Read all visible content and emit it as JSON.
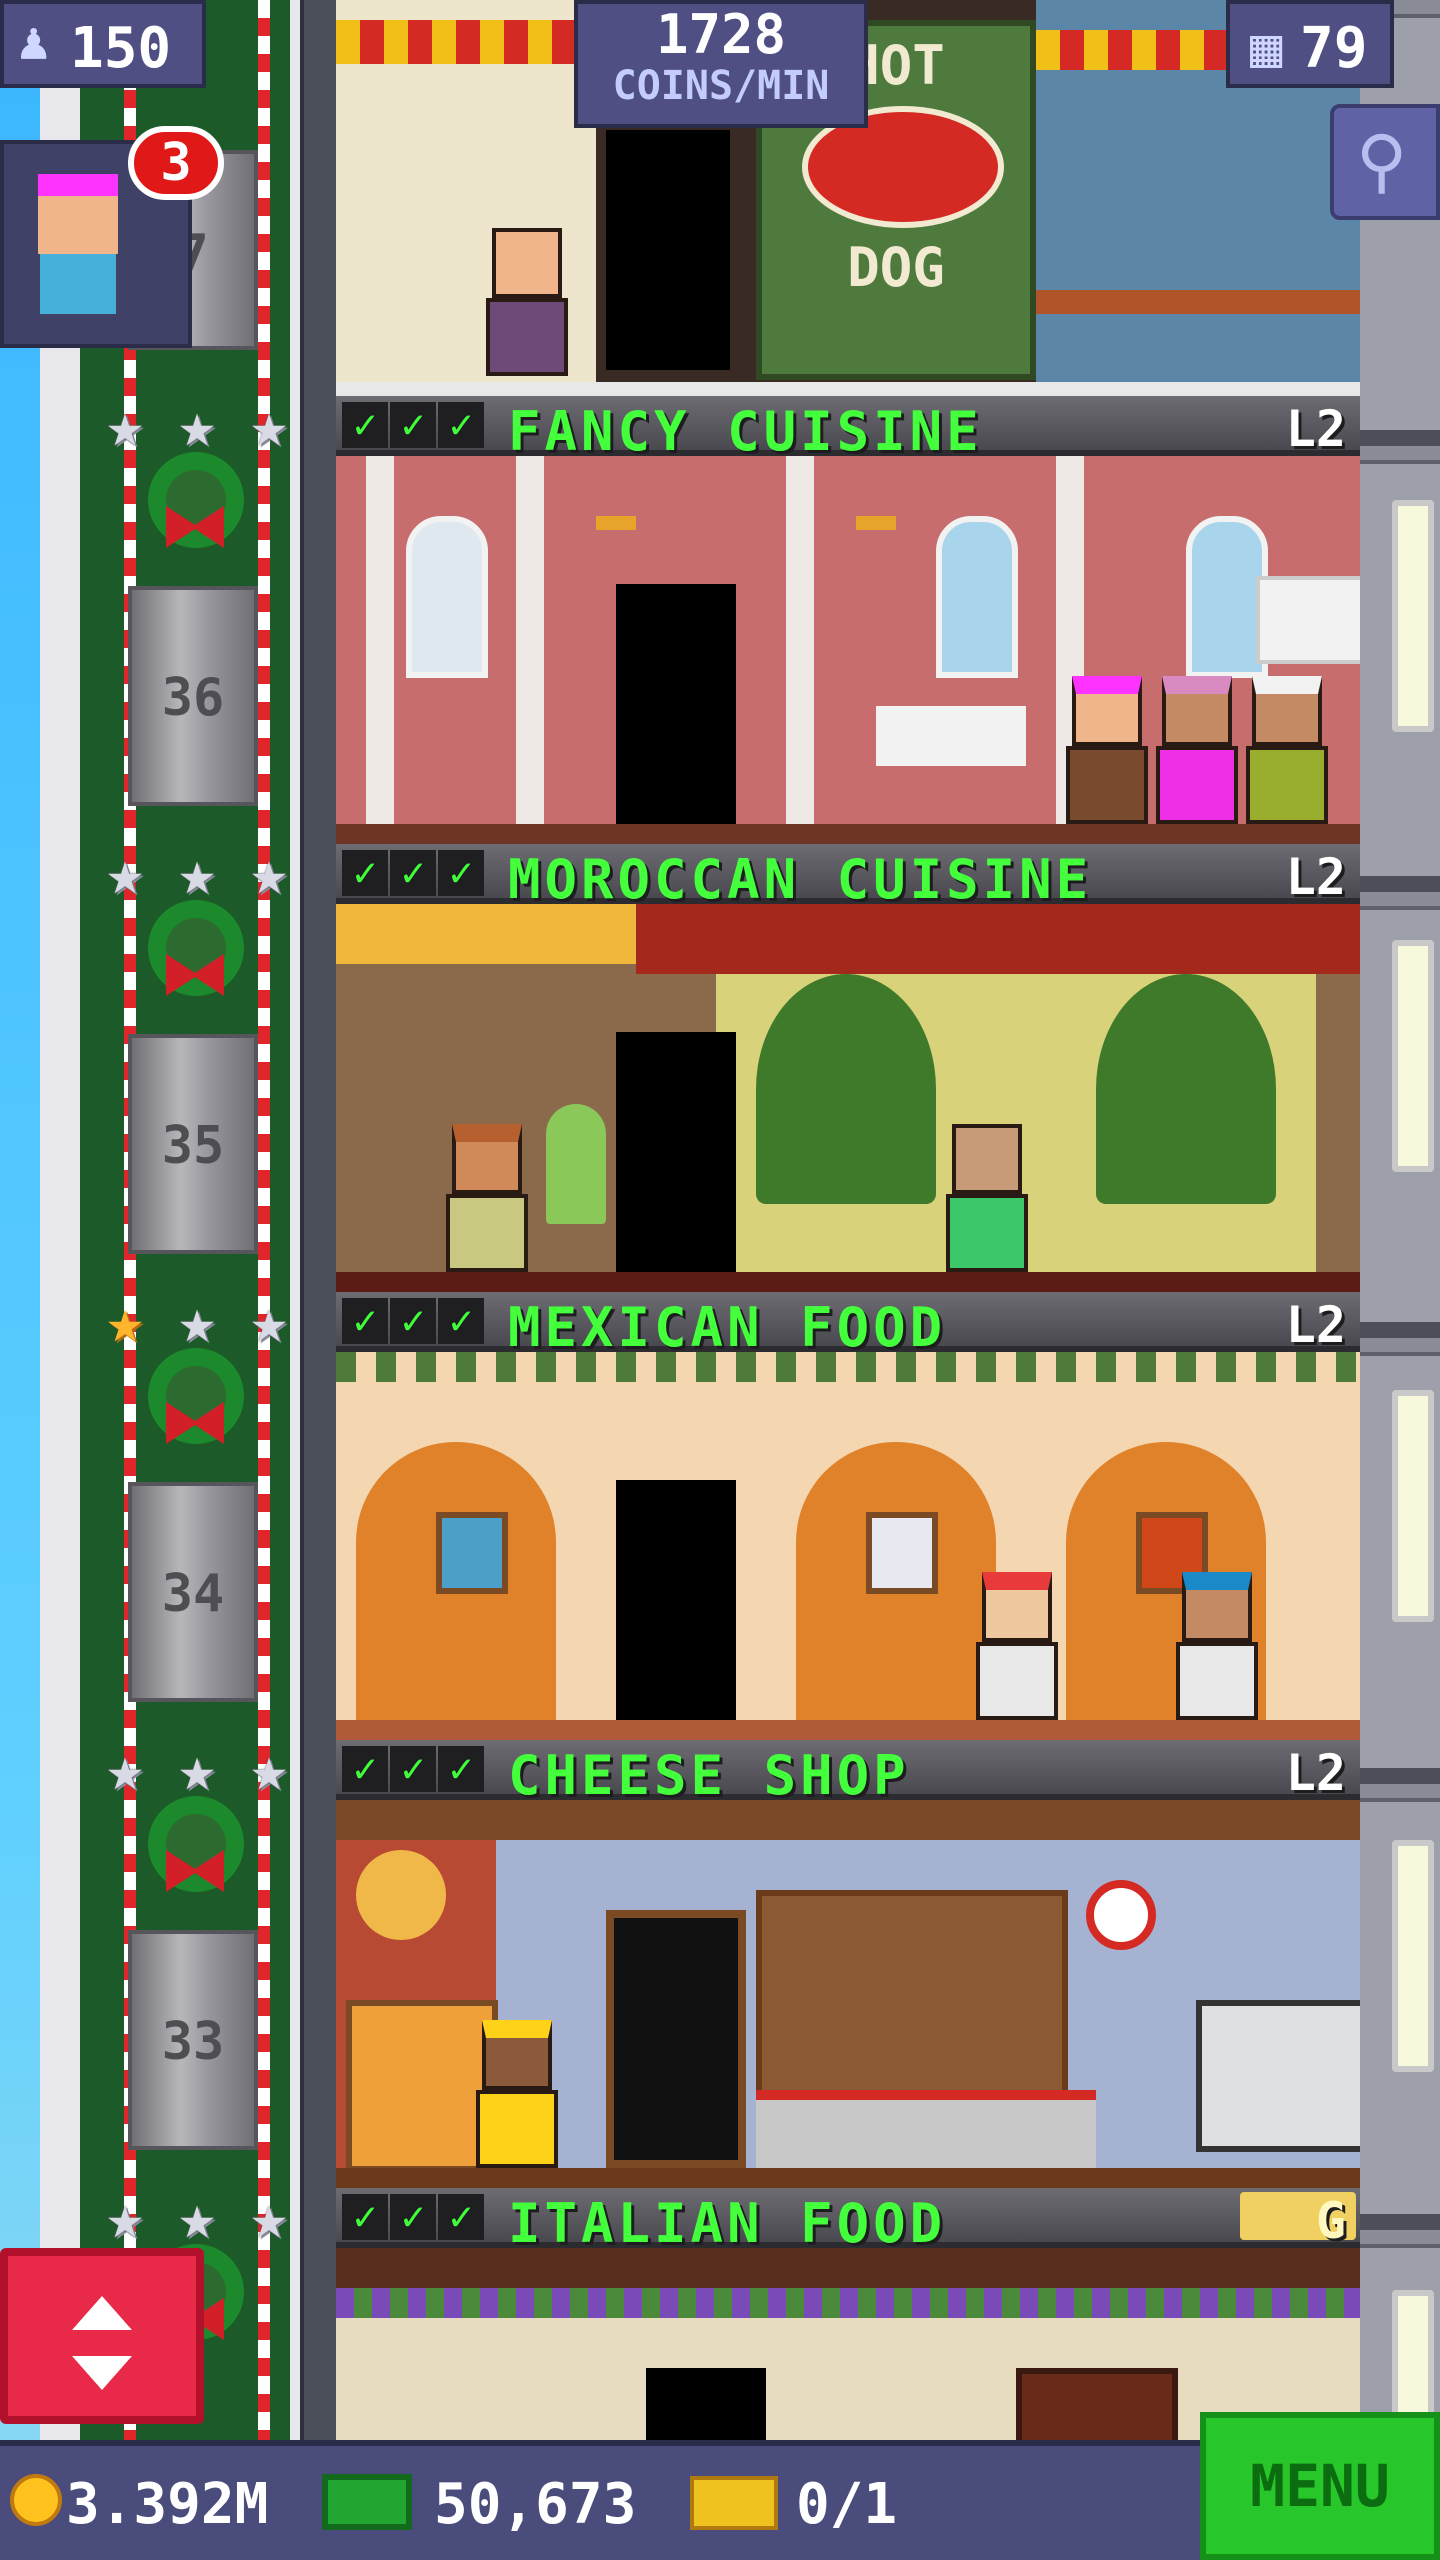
{
  "hud": {
    "population": "150",
    "coins_per_min_value": "1728",
    "coins_per_min_label": "COINS/MIN",
    "floors_count": "79",
    "visitor_badge_count": "3"
  },
  "top_room": {
    "sign_top": "HOT",
    "sign_bottom": "DOG"
  },
  "floors": [
    {
      "name": "FANCY CUISINE",
      "level": "L2",
      "stars_earned": 0,
      "elevator_number": "36"
    },
    {
      "name": "MOROCCAN CUISINE",
      "level": "L2",
      "stars_earned": 0,
      "elevator_number": "35"
    },
    {
      "name": "MEXICAN FOOD",
      "level": "L2",
      "stars_earned": 1,
      "elevator_number": "34"
    },
    {
      "name": "CHEESE SHOP",
      "level": "L2",
      "stars_earned": 0,
      "elevator_number": "33"
    },
    {
      "name": "ITALIAN FOOD",
      "level": "G",
      "stars_earned": 0,
      "elevator_number": ""
    }
  ],
  "top_elevator_number": "7",
  "bottom_bar": {
    "coins": "3.392M",
    "bux": "50,673",
    "tickets": "0/1",
    "menu_label": "MENU"
  },
  "colors": {
    "header_text": "#44ff3c",
    "coins_gold": "#ffc21f",
    "menu_green": "#27c62a",
    "elevator_button": "#e82947"
  }
}
